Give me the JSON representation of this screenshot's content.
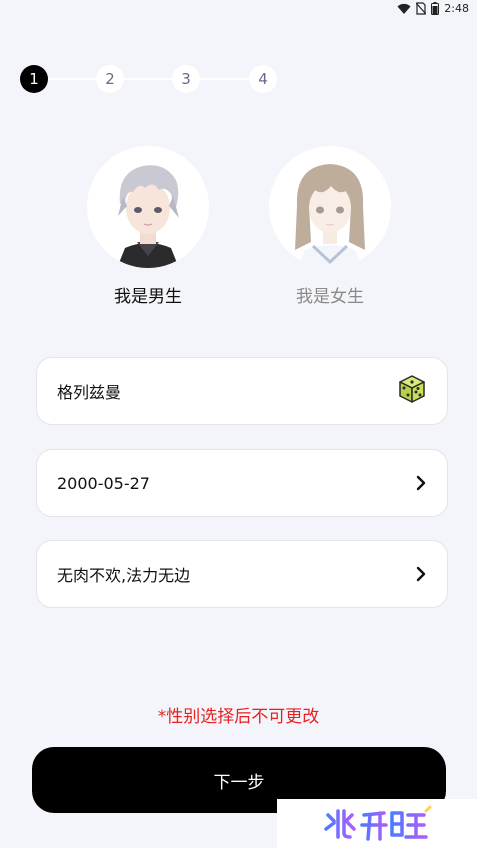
{
  "status_bar": {
    "time": "2:48",
    "icons": [
      "wifi-icon",
      "no-sim-icon",
      "battery-icon"
    ]
  },
  "stepper": {
    "steps": [
      "1",
      "2",
      "3",
      "4"
    ],
    "active_index": 0
  },
  "gender": {
    "male_label": "我是男生",
    "female_label": "我是女生",
    "selected": "male"
  },
  "form": {
    "nickname": "格列兹曼",
    "nickname_action_icon": "dice-icon",
    "birthday": "2000-05-27",
    "signature": "无肉不欢,法力无边"
  },
  "warning": "*性别选择后不可更改",
  "next_label": "下一步",
  "watermark": "兆升旺",
  "colors": {
    "background": "#f4f5fa",
    "primary": "#000000",
    "warning": "#e52222",
    "dice": "#c6e05a"
  }
}
